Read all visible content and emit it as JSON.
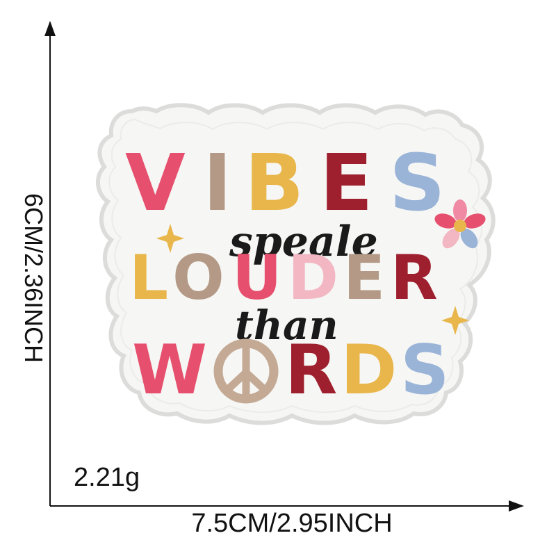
{
  "dimensions": {
    "height_label": "6CM/2.36INCH",
    "width_label": "7.5CM/2.95INCH"
  },
  "weight_label": "2.21g",
  "patch": {
    "line1_letters": [
      "V",
      "I",
      "B",
      "E",
      "S"
    ],
    "line2_script": "speale",
    "line3_letters": [
      "L",
      "O",
      "U",
      "D",
      "E",
      "R"
    ],
    "line4_script": "than",
    "line5_letters": [
      "W",
      "O",
      "R",
      "D",
      "S"
    ],
    "colors": {
      "pink": "#e6506e",
      "tan": "#b49a86",
      "gold": "#e8b64a",
      "crimson": "#9e1f2d",
      "blue": "#9ab4d8",
      "light_pink": "#f2b7c3",
      "black": "#1a1a1a",
      "patch_white": "#f6f6f4",
      "border": "#e2e2e0"
    },
    "icons": [
      "peace-sign-icon",
      "flower-icon",
      "sparkle-icon"
    ]
  }
}
